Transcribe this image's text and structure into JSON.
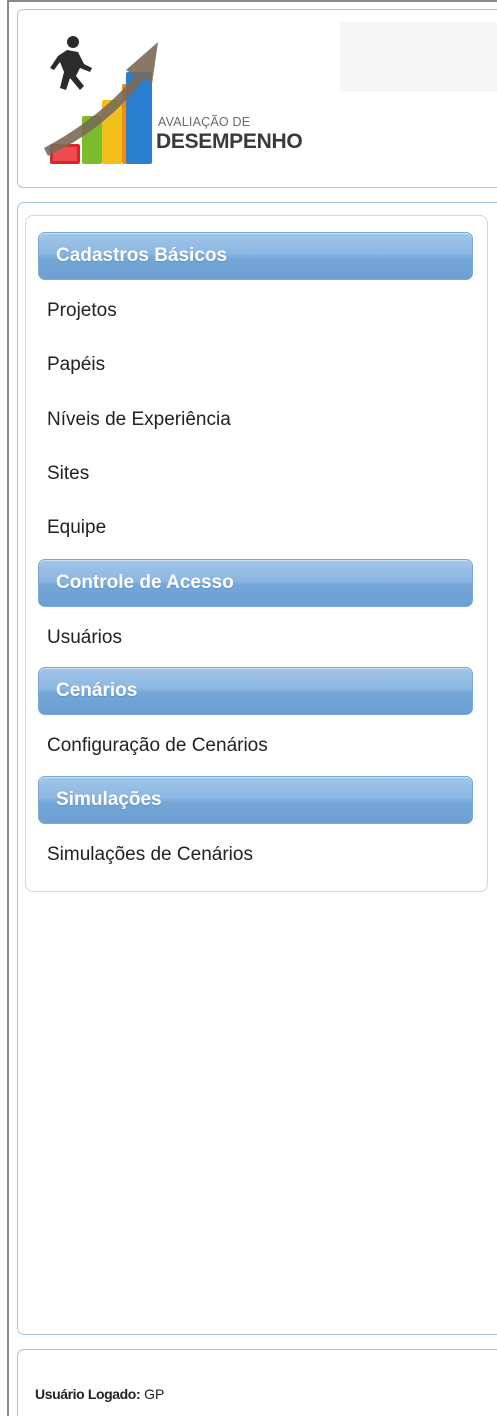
{
  "logo": {
    "line1": "AVALIAÇÃO DE",
    "line2": "DESEMPENHO"
  },
  "menu": {
    "sections": [
      {
        "header": "Cadastros Básicos",
        "items": [
          "Projetos",
          "Papéis",
          "Níveis de Experiência",
          "Sites",
          "Equipe"
        ]
      },
      {
        "header": "Controle de Acesso",
        "items": [
          "Usuários"
        ]
      },
      {
        "header": "Cenários",
        "items": [
          "Configuração de Cenários"
        ]
      },
      {
        "header": "Simulações",
        "items": [
          "Simulações de Cenários"
        ]
      }
    ]
  },
  "footer": {
    "user_label": "Usuário Logado:",
    "user_value": "GP"
  },
  "colors": {
    "header_blue": "#74a6d8",
    "panel_border": "#a9c4e0"
  }
}
